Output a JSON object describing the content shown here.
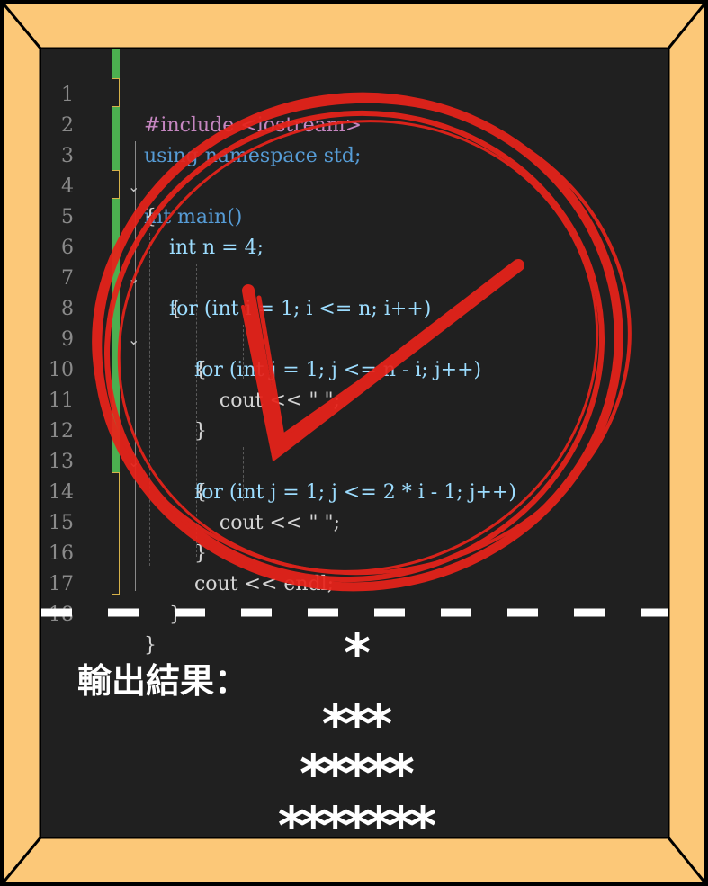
{
  "colors": {
    "frame": "#fcc878",
    "board": "#202020",
    "stamp": "#e8231a",
    "change_bar_green": "#4caf50",
    "change_bar_yellow": "#d6b24a"
  },
  "code": {
    "lines": [
      {
        "n": "1",
        "text": "#include <iostream>"
      },
      {
        "n": "2",
        "text": "using namespace std;"
      },
      {
        "n": "3",
        "text": "int main()"
      },
      {
        "n": "4",
        "text": "{"
      },
      {
        "n": "5",
        "text": "    int n = 4;"
      },
      {
        "n": "6",
        "text": "    for (int i = 1; i <= n; i++)"
      },
      {
        "n": "7",
        "text": "    {"
      },
      {
        "n": "8",
        "text": "        for (int j = 1; j <= n - i; j++)"
      },
      {
        "n": "9",
        "text": "        {"
      },
      {
        "n": "10",
        "text": "            cout << \" \";"
      },
      {
        "n": "11",
        "text": "        }"
      },
      {
        "n": "12",
        "text": "        for (int j = 1; j <= 2 * i - 1; j++)"
      },
      {
        "n": "13",
        "text": "        {"
      },
      {
        "n": "14",
        "text": "            cout << \" \";"
      },
      {
        "n": "15",
        "text": "        }"
      },
      {
        "n": "16",
        "text": "        cout << endl;"
      },
      {
        "n": "17",
        "text": "    }"
      },
      {
        "n": "18",
        "text": "}"
      }
    ]
  },
  "output": {
    "label": "輸出結果：",
    "rows": [
      "*",
      "***",
      "*****",
      "*******"
    ]
  },
  "icons": {
    "fold": "chevron-down-icon",
    "stamp": "check-stamp-icon"
  }
}
